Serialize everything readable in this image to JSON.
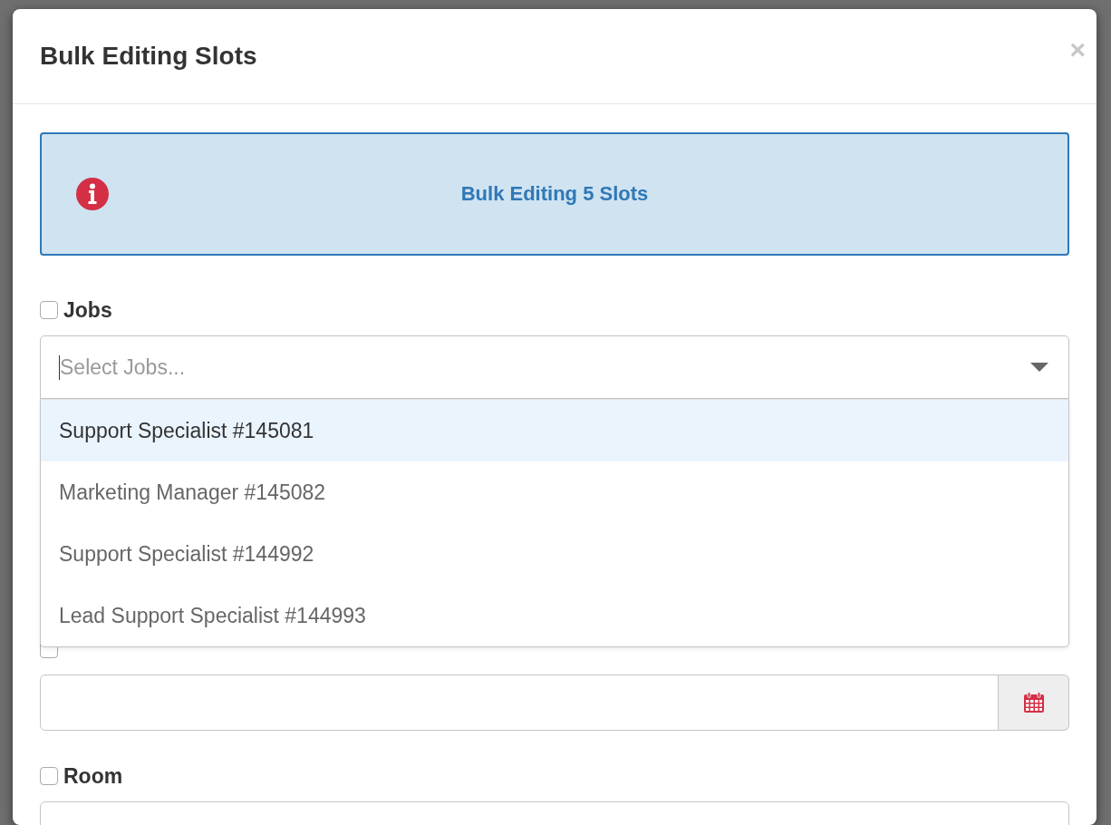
{
  "window": {
    "title": "Bulk Editing Slots",
    "close": "×"
  },
  "alert": {
    "text": "Bulk Editing 5 Slots"
  },
  "fields": [
    {
      "kind": "select",
      "label": "Jobs",
      "checked": false,
      "placeholder": "Select Jobs...",
      "expanded": true,
      "options": [
        {
          "label": "Support Specialist #145081",
          "selected": true
        },
        {
          "label": "Marketing Manager #145082",
          "selected": false
        },
        {
          "label": "Support Specialist #144992",
          "selected": false
        },
        {
          "label": "Lead Support Specialist #144993",
          "selected": false
        }
      ]
    },
    {
      "kind": "date",
      "checked": false
    },
    {
      "kind": "text",
      "label": "Room",
      "checked": false
    }
  ]
}
